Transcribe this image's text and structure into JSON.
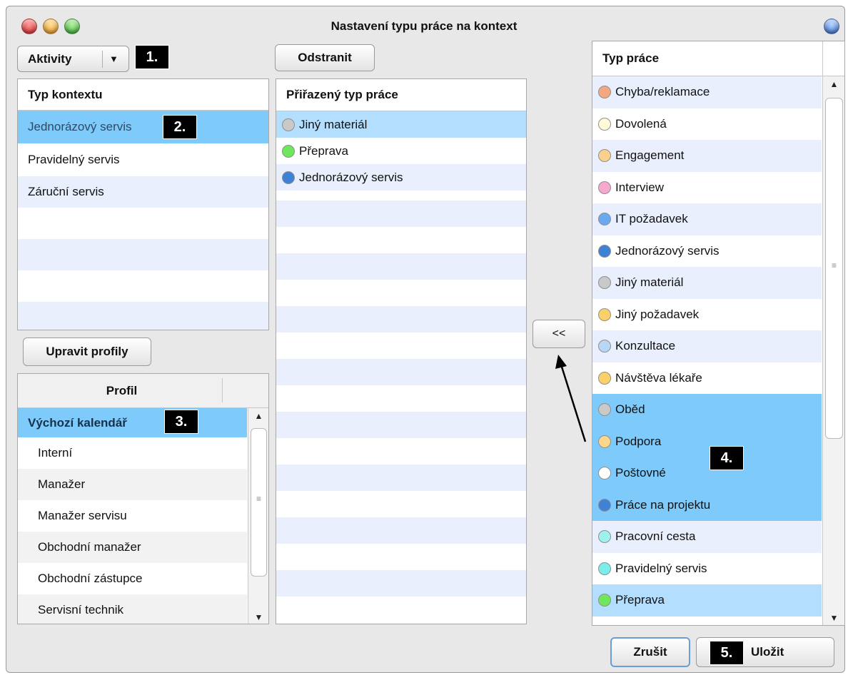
{
  "window": {
    "title": "Nastavení typu práce na kontext"
  },
  "annotations": [
    "1.",
    "2.",
    "3.",
    "4.",
    "5."
  ],
  "toolbar": {
    "activities_label": "Aktivity",
    "activities_arrow": "▼",
    "remove_label": "Odstranit",
    "move_left_label": "<<"
  },
  "context_types": {
    "header": "Typ kontextu",
    "items": [
      "Jednorázový servis",
      "Pravidelný servis",
      "Záruční servis"
    ]
  },
  "profiles": {
    "edit_label": "Upravit profily",
    "header": "Profil",
    "items": [
      "Výchozí kalendář",
      "Interní",
      "Manažer",
      "Manažer servisu",
      "Obchodní manažer",
      "Obchodní zástupce",
      "Servisní technik"
    ]
  },
  "assigned": {
    "header": "Přiřazený typ práce",
    "items": [
      {
        "label": "Jiný materiál",
        "color": "#c9c9c9"
      },
      {
        "label": "Přeprava",
        "color": "#6ee85a"
      },
      {
        "label": "Jednorázový servis",
        "color": "#3e82d6"
      }
    ]
  },
  "work_types": {
    "header": "Typ práce",
    "items": [
      {
        "label": "Chyba/reklamace",
        "color": "#f4a882"
      },
      {
        "label": "Dovolená",
        "color": "#fdfbd8"
      },
      {
        "label": "Engagement",
        "color": "#fbd08c"
      },
      {
        "label": "Interview",
        "color": "#f6a8cf"
      },
      {
        "label": "IT požadavek",
        "color": "#6aa9f0"
      },
      {
        "label": "Jednorázový servis",
        "color": "#3e82d6"
      },
      {
        "label": "Jiný materiál",
        "color": "#c9c9c9"
      },
      {
        "label": "Jiný požadavek",
        "color": "#fcd068"
      },
      {
        "label": "Konzultace",
        "color": "#b8d6f6"
      },
      {
        "label": "Návštěva lékaře",
        "color": "#fcd068"
      },
      {
        "label": "Oběd",
        "color": "#c9c9c9"
      },
      {
        "label": "Podpora",
        "color": "#fcd68a"
      },
      {
        "label": "Poštovné",
        "color": "#ffffff"
      },
      {
        "label": "Práce na projektu",
        "color": "#3e82d6"
      },
      {
        "label": "Pracovní cesta",
        "color": "#9ef2ee"
      },
      {
        "label": "Pravidelný servis",
        "color": "#7aeeec"
      },
      {
        "label": "Přeprava",
        "color": "#6ee85a"
      }
    ]
  },
  "footer": {
    "cancel_label": "Zrušit",
    "save_label": "Uložit"
  },
  "colors": {
    "selection": "#7ecbfb",
    "selection_light": "#b4defd",
    "stripe": "#e9effc"
  }
}
